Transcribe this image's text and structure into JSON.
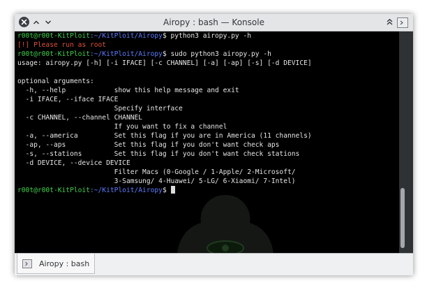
{
  "window": {
    "title": "Airopy : bash — Konsole"
  },
  "terminal": {
    "prompt": {
      "user_host": "r00t@r00t-KitPloit",
      "path": ":~/KitPloit/Airopy",
      "sign": "$"
    },
    "lines": [
      {
        "type": "prompt",
        "cmd": " python3 airopy.py -h"
      },
      {
        "type": "error",
        "text": "[!] Please run as root"
      },
      {
        "type": "prompt",
        "cmd": " sudo python3 airopy.py -h"
      },
      {
        "type": "text",
        "text": "usage: airopy.py [-h] [-i IFACE] [-c CHANNEL] [-a] [-ap] [-s] [-d DEVICE]"
      },
      {
        "type": "text",
        "text": ""
      },
      {
        "type": "text",
        "text": "optional arguments:"
      },
      {
        "type": "text",
        "text": "  -h, --help            show this help message and exit"
      },
      {
        "type": "text",
        "text": "  -i IFACE, --iface IFACE"
      },
      {
        "type": "text",
        "text": "                        Specify interface"
      },
      {
        "type": "text",
        "text": "  -c CHANNEL, --channel CHANNEL"
      },
      {
        "type": "text",
        "text": "                        If you want to fix a channel"
      },
      {
        "type": "text",
        "text": "  -a, --america         Set this flag if you are in America (11 channels)"
      },
      {
        "type": "text",
        "text": "  -ap, --aps            Set this flag if you don't want check aps"
      },
      {
        "type": "text",
        "text": "  -s, --stations        Set this flag if you don't want check stations"
      },
      {
        "type": "text",
        "text": "  -d DEVICE, --device DEVICE"
      },
      {
        "type": "text",
        "text": "                        Filter Macs (0-Google / 1-Apple/ 2-Microsoft/"
      },
      {
        "type": "text",
        "text": "                        3-Samsung/ 4-Huawei/ 5-LG/ 6-Xiaomi/ 7-Intel)"
      },
      {
        "type": "prompt",
        "cmd": " ",
        "cursor": true
      }
    ],
    "scroll_position": 0.78
  },
  "tabs": [
    {
      "label": "Airopy : bash",
      "icon": "terminal-icon",
      "active": true
    }
  ],
  "colors": {
    "prompt_user": "#3fd24a",
    "prompt_path": "#5c7dff",
    "error": "#e0533a",
    "text": "#e6e6e6",
    "background": "#000000"
  }
}
